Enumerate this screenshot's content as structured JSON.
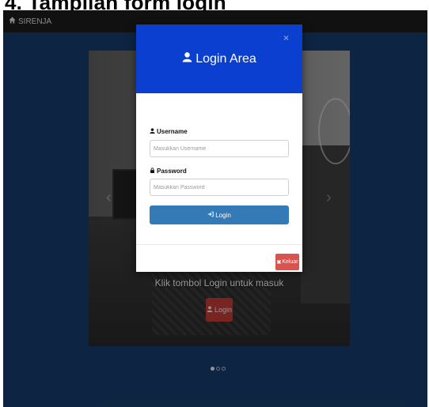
{
  "doc": {
    "caption": "4.   Tampilan form login"
  },
  "navbar": {
    "brand": "SIRENJA",
    "brand_icon": "home-icon"
  },
  "carousel": {
    "caption": "Klik tombol Login untuk masuk",
    "button_label": "Login",
    "indicators": [
      {
        "active": true
      },
      {
        "active": false
      },
      {
        "active": false
      }
    ]
  },
  "modal": {
    "title": "Login Area",
    "close_label": "×",
    "username": {
      "label": "Username",
      "placeholder": "Masukkan Username",
      "value": ""
    },
    "password": {
      "label": "Password",
      "placeholder": "Masukkan Password",
      "value": ""
    },
    "login_label": "Login",
    "keluar_label": "Keluar"
  },
  "colors": {
    "page_bg": "#143a66",
    "navbar": "#1b1b1b",
    "modal_header": "#0a3fcf",
    "primary": "#337ab7",
    "danger": "#d9534f"
  }
}
